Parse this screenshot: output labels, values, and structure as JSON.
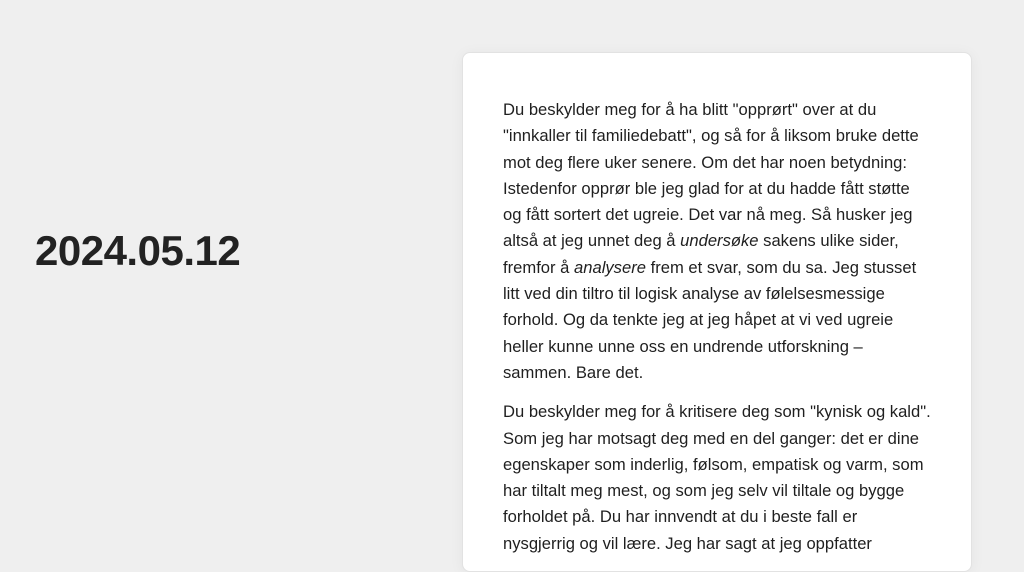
{
  "date": "2024.05.12",
  "paragraphs": [
    {
      "parts": [
        {
          "text": "Du beskylder meg for å ha blitt \"opprørt\" over at du \"innkaller til familiedebatt\", og så for å liksom bruke dette mot deg flere uker senere. Om det har noen betydning: Istedenfor opprør ble jeg glad for at du hadde fått støtte og fått sortert det ugreie. Det var nå meg. Så husker jeg altså at jeg unnet deg å "
        },
        {
          "text": "undersøke",
          "em": true
        },
        {
          "text": " sakens ulike sider, fremfor å "
        },
        {
          "text": "analysere",
          "em": true
        },
        {
          "text": " frem et svar, som du sa. Jeg stusset litt ved din tiltro til logisk analyse av følelsesmessige forhold. Og da tenkte jeg at jeg håpet at vi ved ugreie heller kunne unne oss en undrende utforskning – sammen. Bare det."
        }
      ]
    },
    {
      "parts": [
        {
          "text": "Du beskylder meg for å kritisere deg som \"kynisk og kald\". Som jeg har motsagt deg med en del ganger: det er dine egenskaper som inderlig, følsom, empatisk og varm, som har tiltalt meg mest, og som jeg selv vil tiltale og bygge forholdet på. Du har innvendt at du i beste fall er nysgjerrig og vil lære. Jeg har sagt at jeg oppfatter"
        }
      ]
    }
  ]
}
